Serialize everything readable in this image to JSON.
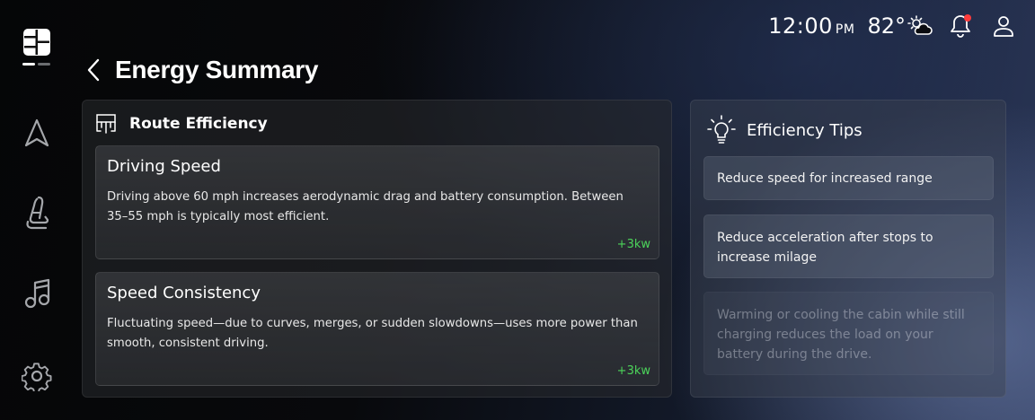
{
  "status": {
    "time": "12:00",
    "ampm": "PM",
    "temperature": "82°",
    "weather_icon": "partly-cloudy-icon",
    "notification_dot_color": "#ff3b3b"
  },
  "header": {
    "title": "Energy Summary"
  },
  "sidebar": {
    "items": [
      {
        "name": "home",
        "icon": "grid-home-icon"
      },
      {
        "name": "navigation",
        "icon": "navigation-arrow-icon"
      },
      {
        "name": "seat",
        "icon": "seat-icon"
      },
      {
        "name": "media",
        "icon": "music-note-icon"
      },
      {
        "name": "settings",
        "icon": "gear-icon"
      }
    ]
  },
  "route_efficiency": {
    "title": "Route Efficiency",
    "cards": [
      {
        "title": "Driving Speed",
        "body": "Driving above 60 mph increases aerodynamic drag and battery consumption. Between 35–55 mph is typically most efficient.",
        "delta": "+3kw"
      },
      {
        "title": "Speed Consistency",
        "body": "Fluctuating speed—due to curves, merges, or sudden slowdowns—uses more power than smooth, consistent driving.",
        "delta": "+3kw"
      }
    ]
  },
  "efficiency_tips": {
    "title": "Efficiency Tips",
    "tips": [
      "Reduce speed for increased range",
      "Reduce acceleration after stops to increase milage",
      "Warming or cooling the cabin while still charging reduces the load on your battery during the drive."
    ]
  },
  "colors": {
    "positive": "#4cd45a",
    "alert": "#ff3b3b"
  }
}
